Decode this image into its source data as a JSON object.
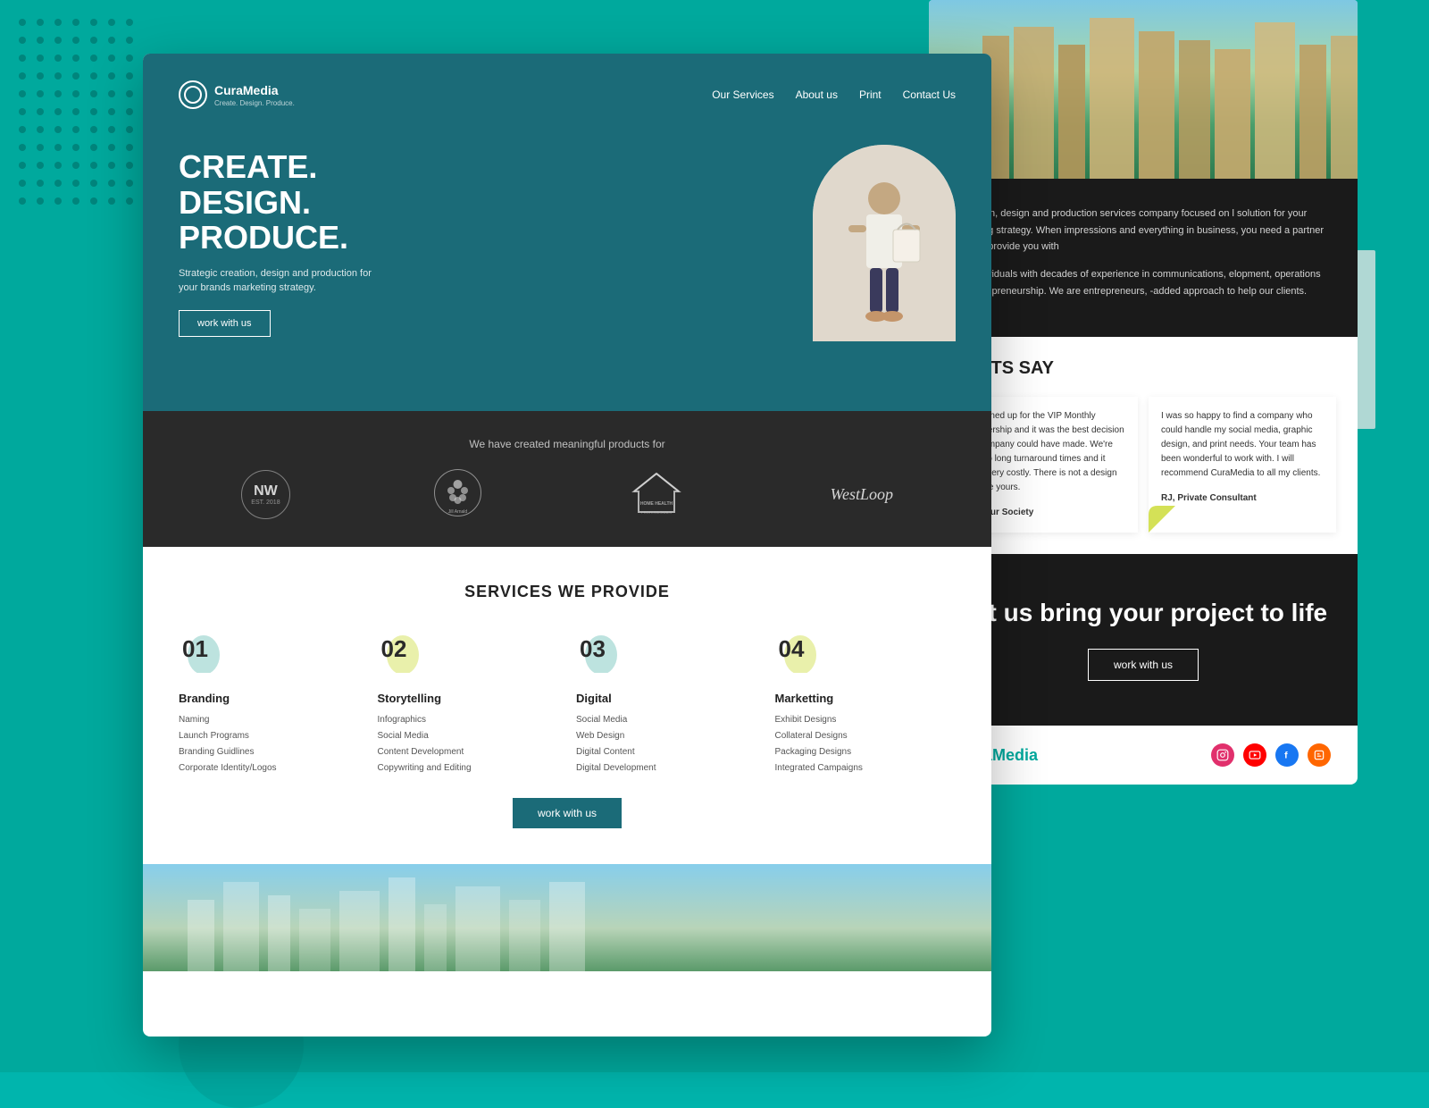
{
  "background": {
    "color": "#00A99D"
  },
  "browser_window": {
    "hero": {
      "logo_name": "CuraMedia",
      "logo_tagline": "Create. Design. Produce.",
      "nav_links": [
        "Our Services",
        "About us",
        "Print",
        "Contact Us"
      ],
      "headline_line1": "CREATE.",
      "headline_line2": "DESIGN.",
      "headline_line3": "PRODUCE.",
      "subtext": "Strategic creation, design and production for your brands marketing strategy.",
      "cta_button": "work with us"
    },
    "clients_bar": {
      "intro_text": "We have created meaningful products for",
      "logos": [
        "NW",
        "Jill Arnald PourtHealth",
        "HOME HEALTH PROFESSIONALS",
        "WestLoop"
      ]
    },
    "services": {
      "section_title": "SERVICES WE PROVIDE",
      "cta_button": "work with us",
      "items": [
        {
          "number": "01",
          "name": "Branding",
          "list": [
            "Naming",
            "Launch Programs",
            "Branding Guidlines",
            "Corporate Identity/Logos"
          ]
        },
        {
          "number": "02",
          "name": "Storytelling",
          "list": [
            "Infographics",
            "Social Media",
            "Content Development",
            "Copywriting and Editing"
          ]
        },
        {
          "number": "03",
          "name": "Digital",
          "list": [
            "Social Media",
            "Web Design",
            "Digital Content",
            "Digital Development"
          ]
        },
        {
          "number": "04",
          "name": "Marketting",
          "list": [
            "Exhibit Designs",
            "Collateral Designs",
            "Packaging Designs",
            "Integrated Campaigns"
          ]
        }
      ]
    }
  },
  "right_panel": {
    "about_text_1": "ic creation, design and production services company focused on l solution for your marketing strategy. When impressions and everything in business, you need a partner that can provide you with",
    "about_text_2": "d by individuals with decades of experience in communications, elopment, operations and entrepreneurship. We are entrepreneurs, -added approach to help our clients.",
    "testimonials_heading": "LIENTS SAY",
    "testimonials": [
      {
        "text": "We signed up for the VIP Monthly Membership and it was the best decision our company could have made. We're used to long turnaround times and it being very costly. There is not a design firm like yours.",
        "author": "TA, Pour Society"
      },
      {
        "text": "I was so happy to find a company who could handle my social media, graphic design, and print needs. Your team has been wonderful to work with. I will recommend CuraMedia to all my clients.",
        "author": "RJ, Private Consultant"
      }
    ],
    "cta_heading": "Let us bring your project to life",
    "cta_button": "work with us",
    "footer_logo": "CuraMedia",
    "social_icons": [
      "instagram",
      "youtube",
      "facebook",
      "blogger"
    ]
  }
}
